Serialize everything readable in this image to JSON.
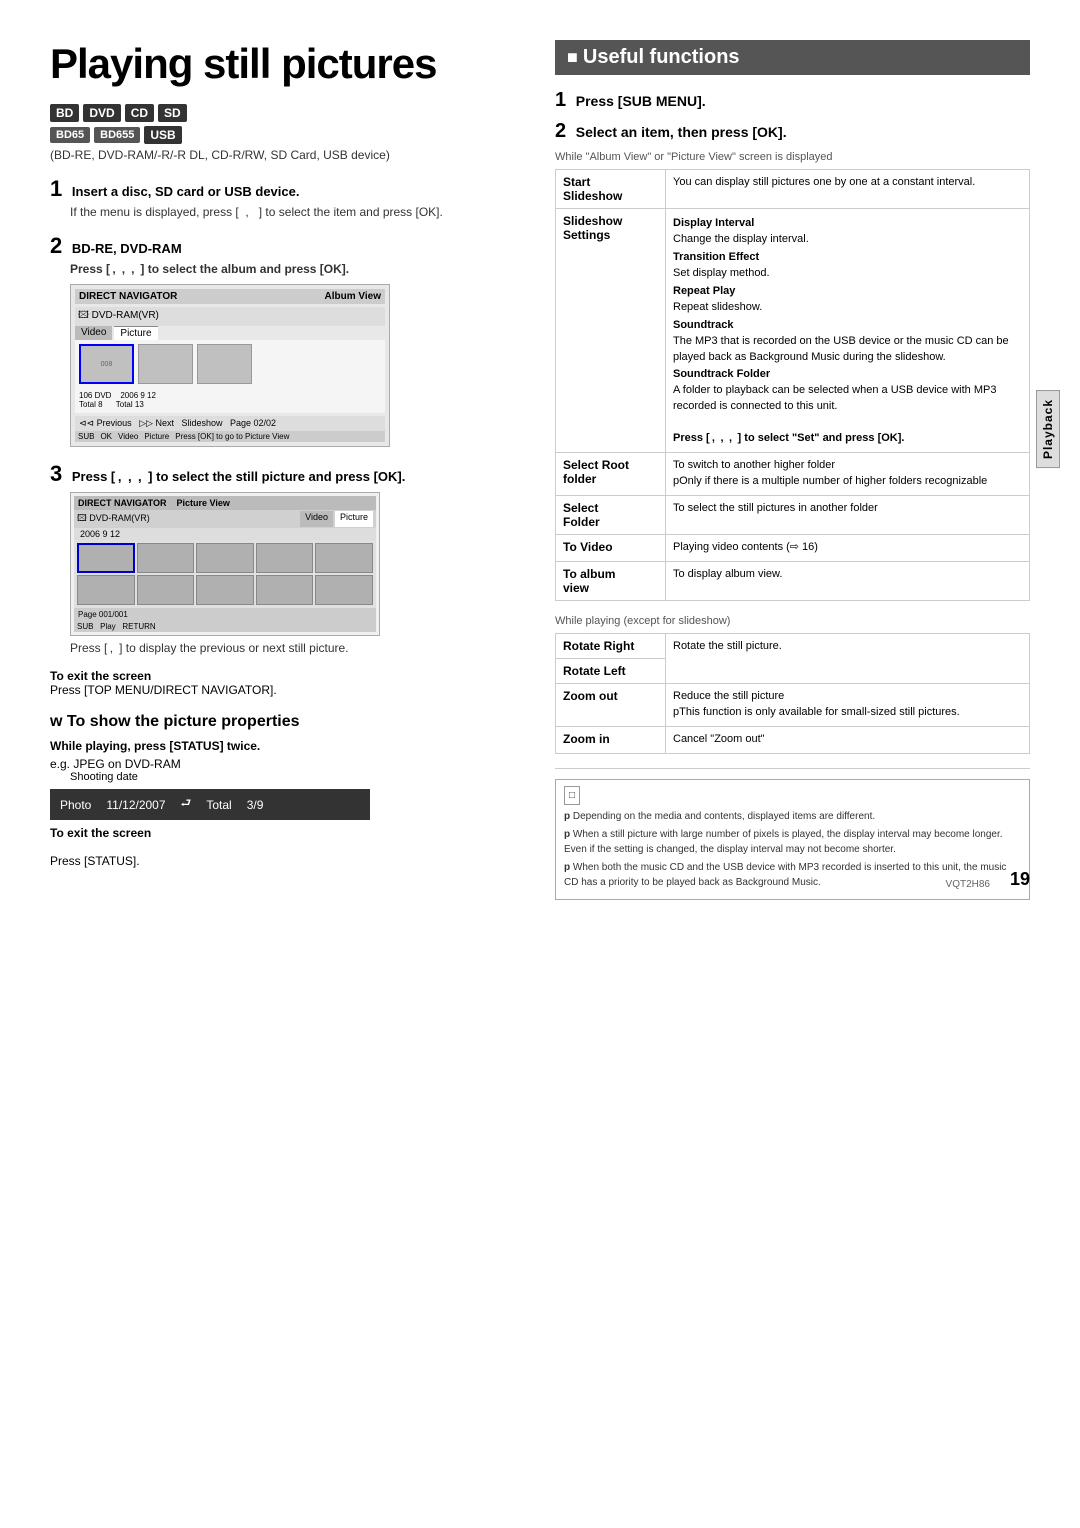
{
  "page": {
    "title": "Playing still pictures",
    "page_number": "19",
    "vqt_code": "VQT2H86"
  },
  "badges": {
    "row1": [
      "BD",
      "DVD",
      "CD",
      "SD"
    ],
    "row2_left": [
      "BD65",
      "BD655"
    ],
    "row2_right": "USB",
    "subtitle": "(BD-RE, DVD-RAM/-R/-R DL, CD-R/RW, SD Card, USB device)"
  },
  "steps_left": [
    {
      "number": "1",
      "title": "Insert a disc, SD card or USB device.",
      "body": "If the menu is displayed, press [   ,   ] to select the item and press [OK]."
    },
    {
      "number": "2",
      "title": "BD-RE, DVD-RAM",
      "subtitle": "Press [  ,   ,   ,   ] to select the album and press [OK].",
      "screen1": {
        "header": "DIRECT NAVIGATOR",
        "label": "Album View",
        "source": "DVD-RAM(VR)",
        "tabs": [
          "Video",
          "Picture"
        ],
        "info": "106 DVD   2006 9 12\nTotal 8   Total 13",
        "footer": "Previous  Next  Slideshow  Page 02/02\nSUB  OK  Video  Picture  Press [OK] to go to Picture View"
      }
    },
    {
      "number": "3",
      "title": "Press [  ,   ,   ,   ] to select the still picture and press [OK].",
      "screen2": {
        "header": "DIRECT NAVIGATOR  Picture View",
        "source": "DVD-RAM(VR)",
        "tabs": [
          "Video",
          "Picture"
        ],
        "date": "2006 9 12",
        "footer": "Page 001/001\nSUB  Play  RETURN"
      },
      "below_text": "Press [  ,   ] to display the previous or next still picture."
    }
  ],
  "exit_screen": {
    "title": "To exit the screen",
    "text": "Press [TOP MENU/DIRECT NAVIGATOR]."
  },
  "show_picture": {
    "title": "To show the picture properties",
    "step": "While playing, press [STATUS] twice.",
    "example": "e.g. JPEG on DVD-RAM",
    "shooting_label": "Shooting date",
    "photo_bar": {
      "label": "Photo",
      "date": "11/12/2007",
      "total_label": "Total",
      "total": "3/9"
    },
    "exit_title": "To exit the screen",
    "exit_text": "Press [STATUS]."
  },
  "right": {
    "section_title": "Useful functions",
    "step1": "Press [SUB MENU].",
    "step2": "Select an item, then press [OK].",
    "while_text": "While \"Album View\" or \"Picture View\" screen is displayed",
    "table1": [
      {
        "key": "Start\nSlideshow",
        "value": "You can display still pictures one by one at a constant interval."
      },
      {
        "key": "Slideshow\nSettings",
        "value": "Display Interval\nChange the display interval.\nTransition Effect\nSet display method.\nRepeat Play\nRepeat slideshow.\nSoundtrack\nThe MP3 that is recorded on the USB device or the music CD can be played back as Background Music during the slideshow.\nSoundtrack Folder\nA folder to playback can be selected when a USB device with MP3 recorded is connected to this unit.\nPress [  ,   ,   ,   ] to select \"Set\" and press [OK]."
      },
      {
        "key": "Select Root\nfolder",
        "value": "To switch to another higher folder\npOnly if there is a multiple number of higher folders recognizable"
      },
      {
        "key": "Select\nFolder",
        "value": "To select the still pictures in another folder"
      },
      {
        "key": "To Video",
        "value": "Playing video contents (⇨ 16)"
      },
      {
        "key": "To album\nview",
        "value": "To display album view."
      }
    ],
    "while_text2": "While playing (except for slideshow)",
    "table2": [
      {
        "key": "Rotate Right",
        "value": "Rotate the still picture."
      },
      {
        "key": "Rotate Left",
        "value": ""
      },
      {
        "key": "Zoom out",
        "value": "Reduce the still picture\npThis function is only available for small-sized still pictures."
      },
      {
        "key": "Zoom in",
        "value": "Cancel \"Zoom out\""
      }
    ],
    "notes": [
      "Depending on the media and contents, displayed items are different.",
      "When a still picture with large number of pixels is played, the display interval may become longer. Even if the setting is changed, the display interval may not become shorter.",
      "When both the music CD and the USB device with MP3 recorded is inserted to this unit, the music CD has a priority to be played back as Background Music."
    ]
  },
  "playback_tab": "Playback"
}
